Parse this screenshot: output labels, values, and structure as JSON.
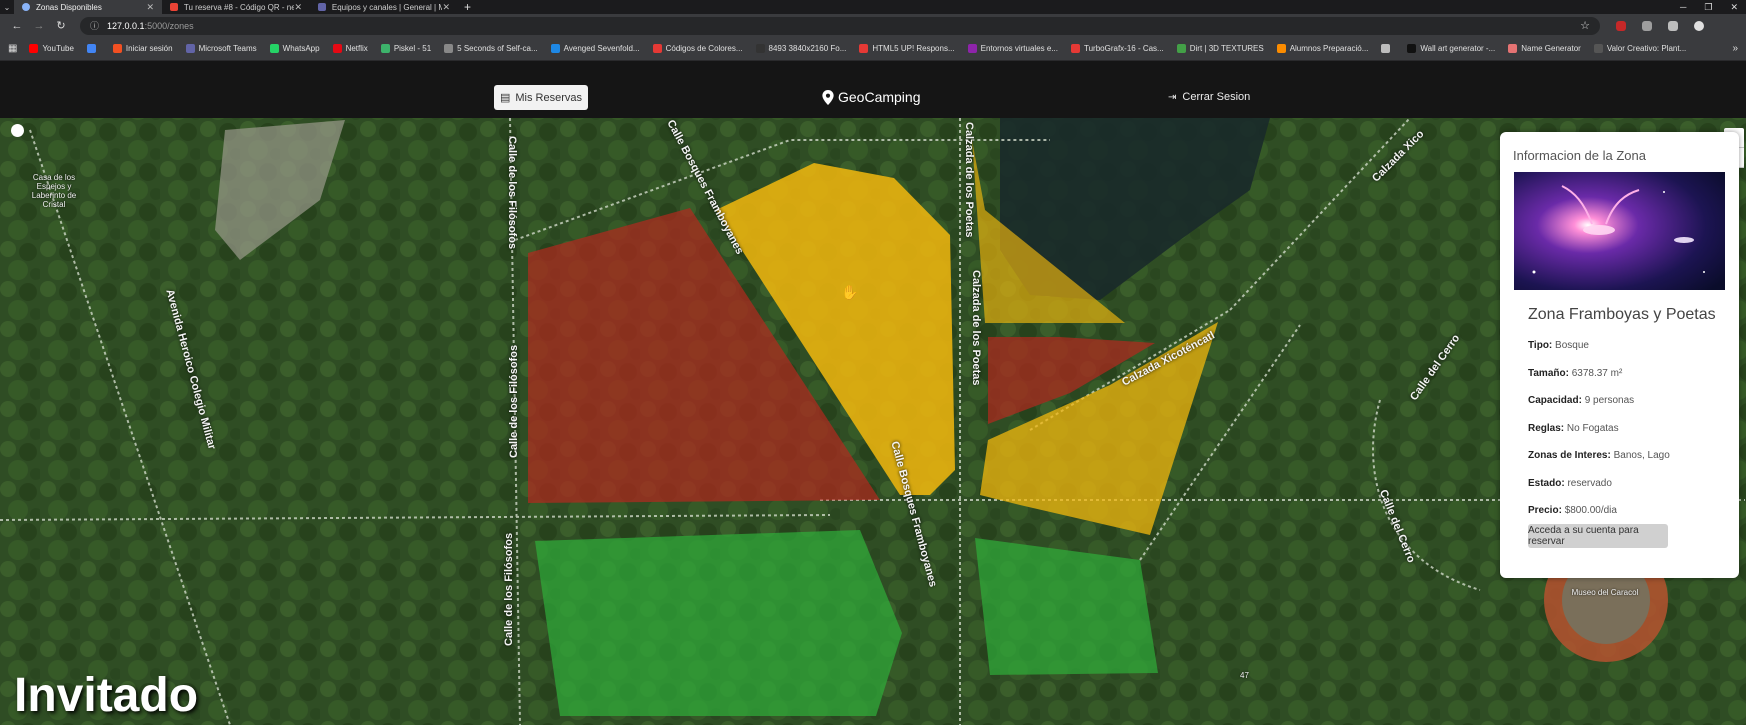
{
  "browser": {
    "tabs": [
      {
        "label": "Zonas Disponibles",
        "icon": "globe-icon",
        "active": true
      },
      {
        "label": "Tu reserva #8 - Código QR - ne",
        "icon": "gmail-icon",
        "active": false
      },
      {
        "label": "Equipos y canales | General | M",
        "icon": "teams-icon",
        "active": false
      }
    ],
    "url_host": "127.0.0.1",
    "url_path": ":5000/zones",
    "bookmarks": [
      {
        "label": "YouTube",
        "color": "#ff0000"
      },
      {
        "label": "",
        "color": "#4285f4"
      },
      {
        "label": "Iniciar sesión",
        "color": "#f25022"
      },
      {
        "label": "Microsoft Teams",
        "color": "#6264a7"
      },
      {
        "label": "WhatsApp",
        "color": "#25d366"
      },
      {
        "label": "Netflix",
        "color": "#e50914"
      },
      {
        "label": "Piskel - 51",
        "color": "#3db36b"
      },
      {
        "label": "5 Seconds of Self-ca...",
        "color": "#888888"
      },
      {
        "label": "Avenged Sevenfold...",
        "color": "#1e88e5"
      },
      {
        "label": "Códigos de Colores...",
        "color": "#e53935"
      },
      {
        "label": "8493 3840x2160 Fo...",
        "color": "#333333"
      },
      {
        "label": "HTML5 UP! Respons...",
        "color": "#e53935"
      },
      {
        "label": "Entornos virtuales e...",
        "color": "#8e24aa"
      },
      {
        "label": "TurboGrafx-16 - Cas...",
        "color": "#e53935"
      },
      {
        "label": "Dirt | 3D TEXTURES",
        "color": "#43a047"
      },
      {
        "label": "Alumnos Preparació...",
        "color": "#fb8c00"
      },
      {
        "label": "",
        "color": "#bdbdbd"
      },
      {
        "label": "Wall art generator -...",
        "color": "#111111"
      },
      {
        "label": "Name Generator",
        "color": "#e57373"
      },
      {
        "label": "Valor Creativo: Plant...",
        "color": "#555555"
      }
    ]
  },
  "nav": {
    "reservas_label": "Mis Reservas",
    "brand": "GeoCamping",
    "logout_label": "Cerrar Sesion"
  },
  "map": {
    "labels": {
      "filosofos_top": "Calle de los Filósofos",
      "filosofos_mid": "Calle de los Filósofos",
      "filosofos_bottom": "Calle de los Filósofos",
      "bosques_top": "Calle Bosques Framboyanes",
      "bosques_bottom": "Calle Bosques Framboyanes",
      "poetas_top": "Calzada de los Poetas",
      "poetas_mid": "Calzada de los Poetas",
      "xicotencatl": "Calzada Xicoténcatl",
      "xico_top": "Calzada Xico",
      "colegio_militar": "Avenida Heroico Colegio Militar",
      "cerro_top": "Calle del Cerro",
      "cerro_bottom": "Calle del Cerro"
    },
    "poi": {
      "casa_espejos": "Casa de los Espejos y Laberinto de Cristal",
      "museo": "Museo del Caracol",
      "num": "47"
    },
    "user_label": "Invitado",
    "zoom_in": "+",
    "zoom_out": "−",
    "zone_colors": {
      "reservado": "#b02a1f",
      "disponible": "#f3b80e",
      "libre": "#2fae3a"
    }
  },
  "info": {
    "heading": "Informacion de la Zona",
    "zone_name": "Zona Framboyas y Poetas",
    "tipo_label": "Tipo:",
    "tipo": "Bosque",
    "tamano_label": "Tamaño:",
    "tamano": "6378.37 m²",
    "capacidad_label": "Capacidad:",
    "capacidad": "9 personas",
    "reglas_label": "Reglas:",
    "reglas": "No Fogatas",
    "interes_label": "Zonas de Interes:",
    "interes": "Banos, Lago",
    "estado_label": "Estado:",
    "estado": "reservado",
    "precio_label": "Precio:",
    "precio": "$800.00/dia",
    "login_button": "Acceda a su cuenta para reservar"
  }
}
